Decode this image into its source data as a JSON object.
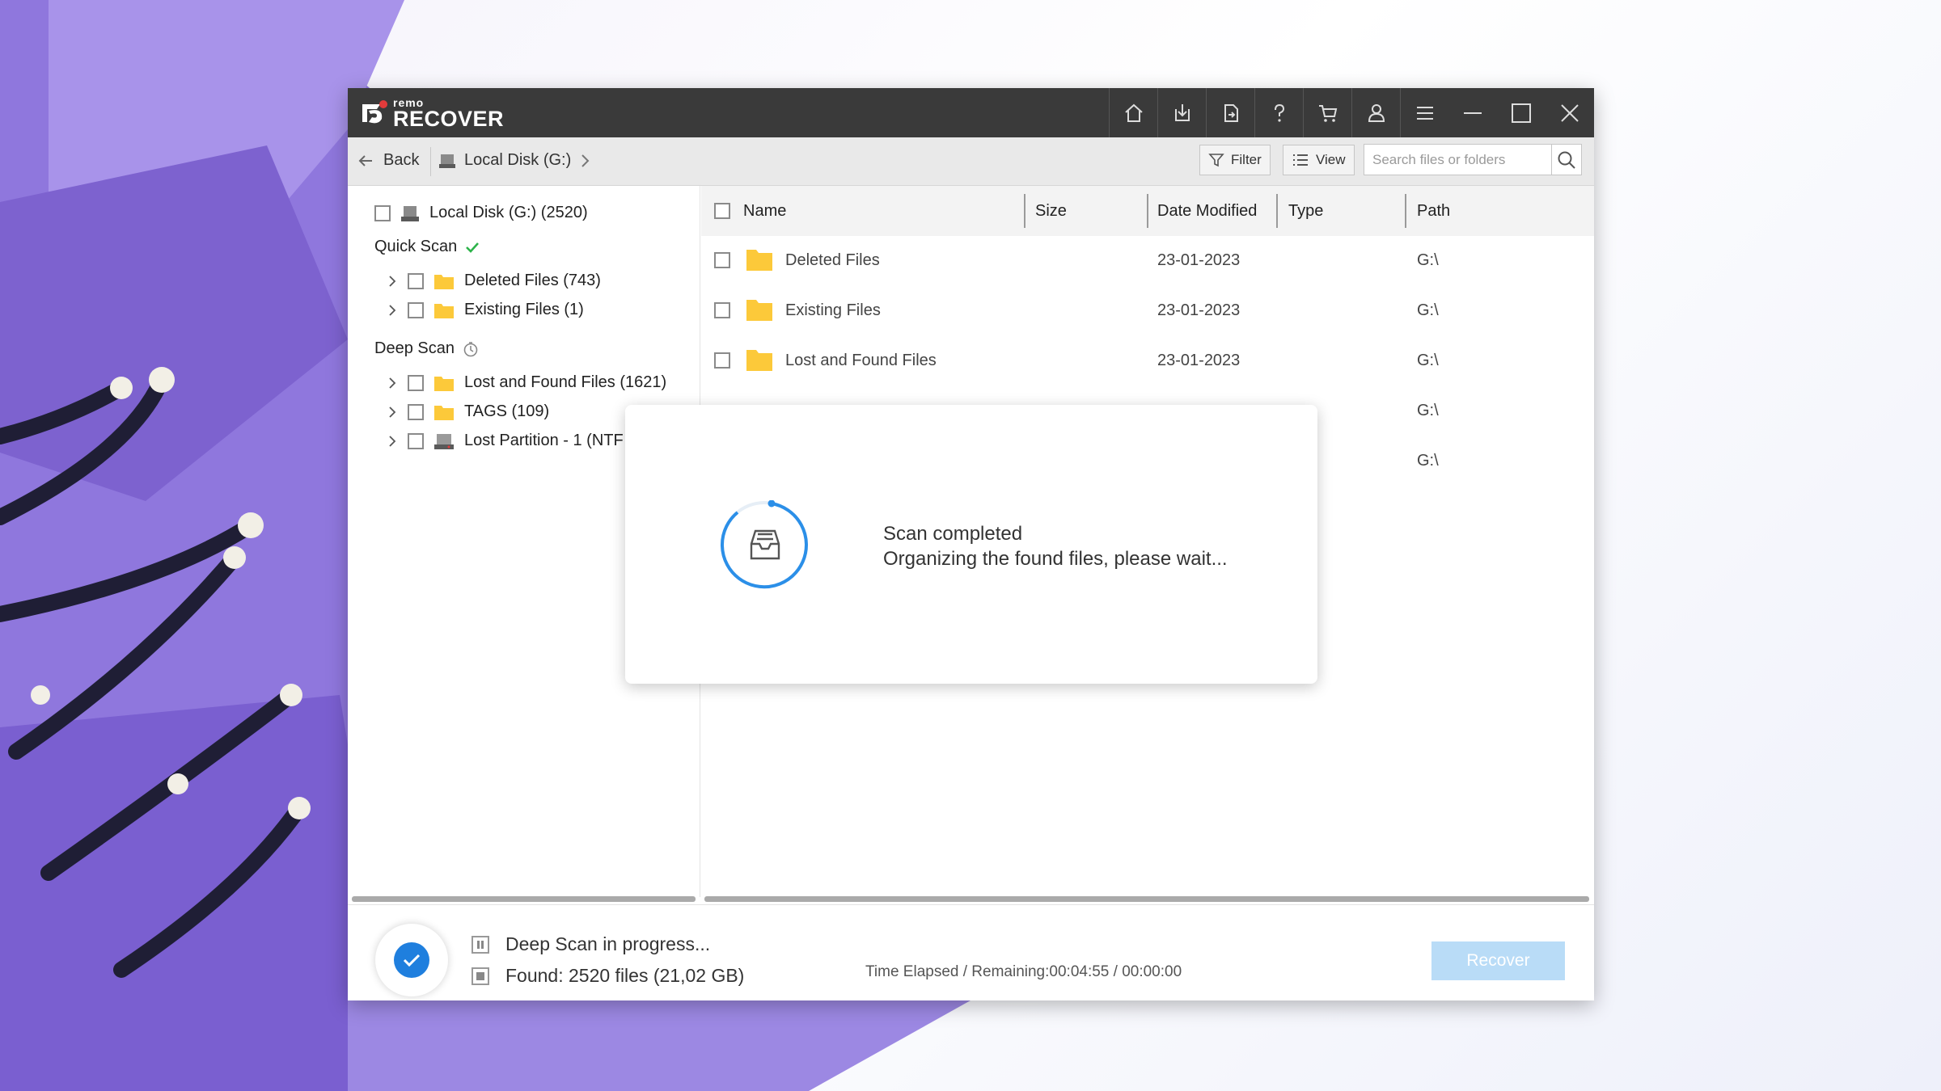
{
  "app": {
    "brand_small": "remo",
    "brand_large": "RECOVER"
  },
  "titlebar_icons": [
    "home-icon",
    "save-session-icon",
    "load-session-icon",
    "help-icon",
    "cart-icon",
    "user-icon",
    "menu-icon",
    "minimize-icon",
    "maximize-icon",
    "close-icon"
  ],
  "nav": {
    "back_label": "Back",
    "breadcrumb": "Local Disk (G:)",
    "filter_label": "Filter",
    "view_label": "View",
    "search_placeholder": "Search files or folders"
  },
  "tree": {
    "root": "Local Disk (G:) (2520)",
    "quick_scan": {
      "label": "Quick Scan",
      "items": [
        "Deleted Files (743)",
        "Existing Files (1)"
      ]
    },
    "deep_scan": {
      "label": "Deep Scan",
      "items": [
        "Lost and Found Files (1621)",
        "TAGS (109)",
        "Lost Partition - 1 (NTF"
      ]
    }
  },
  "table": {
    "columns": [
      "Name",
      "Size",
      "Date Modified",
      "Type",
      "Path"
    ],
    "rows": [
      {
        "name": "Deleted Files",
        "size": "",
        "date": "23-01-2023",
        "type": "",
        "path": "G:\\"
      },
      {
        "name": "Existing Files",
        "size": "",
        "date": "23-01-2023",
        "type": "",
        "path": "G:\\"
      },
      {
        "name": "Lost and Found Files",
        "size": "",
        "date": "23-01-2023",
        "type": "",
        "path": "G:\\"
      },
      {
        "name": "",
        "size": "",
        "date": "",
        "type": "",
        "path": "G:\\"
      },
      {
        "name": "",
        "size": "",
        "date": "",
        "type": "",
        "path": "G:\\"
      }
    ]
  },
  "modal": {
    "line1": "Scan completed",
    "line2": "Organizing the found files, please wait..."
  },
  "bottom": {
    "status_label": "Deep Scan in progress...",
    "found_label": "Found:",
    "found_value": "2520 files (21,02 GB)",
    "time_label": "Time Elapsed / Remaining:",
    "time_value": "00:04:55 / 00:00:00",
    "recover_label": "Recover"
  },
  "colors": {
    "titlebar": "#3a3a3a",
    "accent": "#1f7fde",
    "folder": "#fcc93a",
    "recover_disabled": "#b9dcf7"
  }
}
